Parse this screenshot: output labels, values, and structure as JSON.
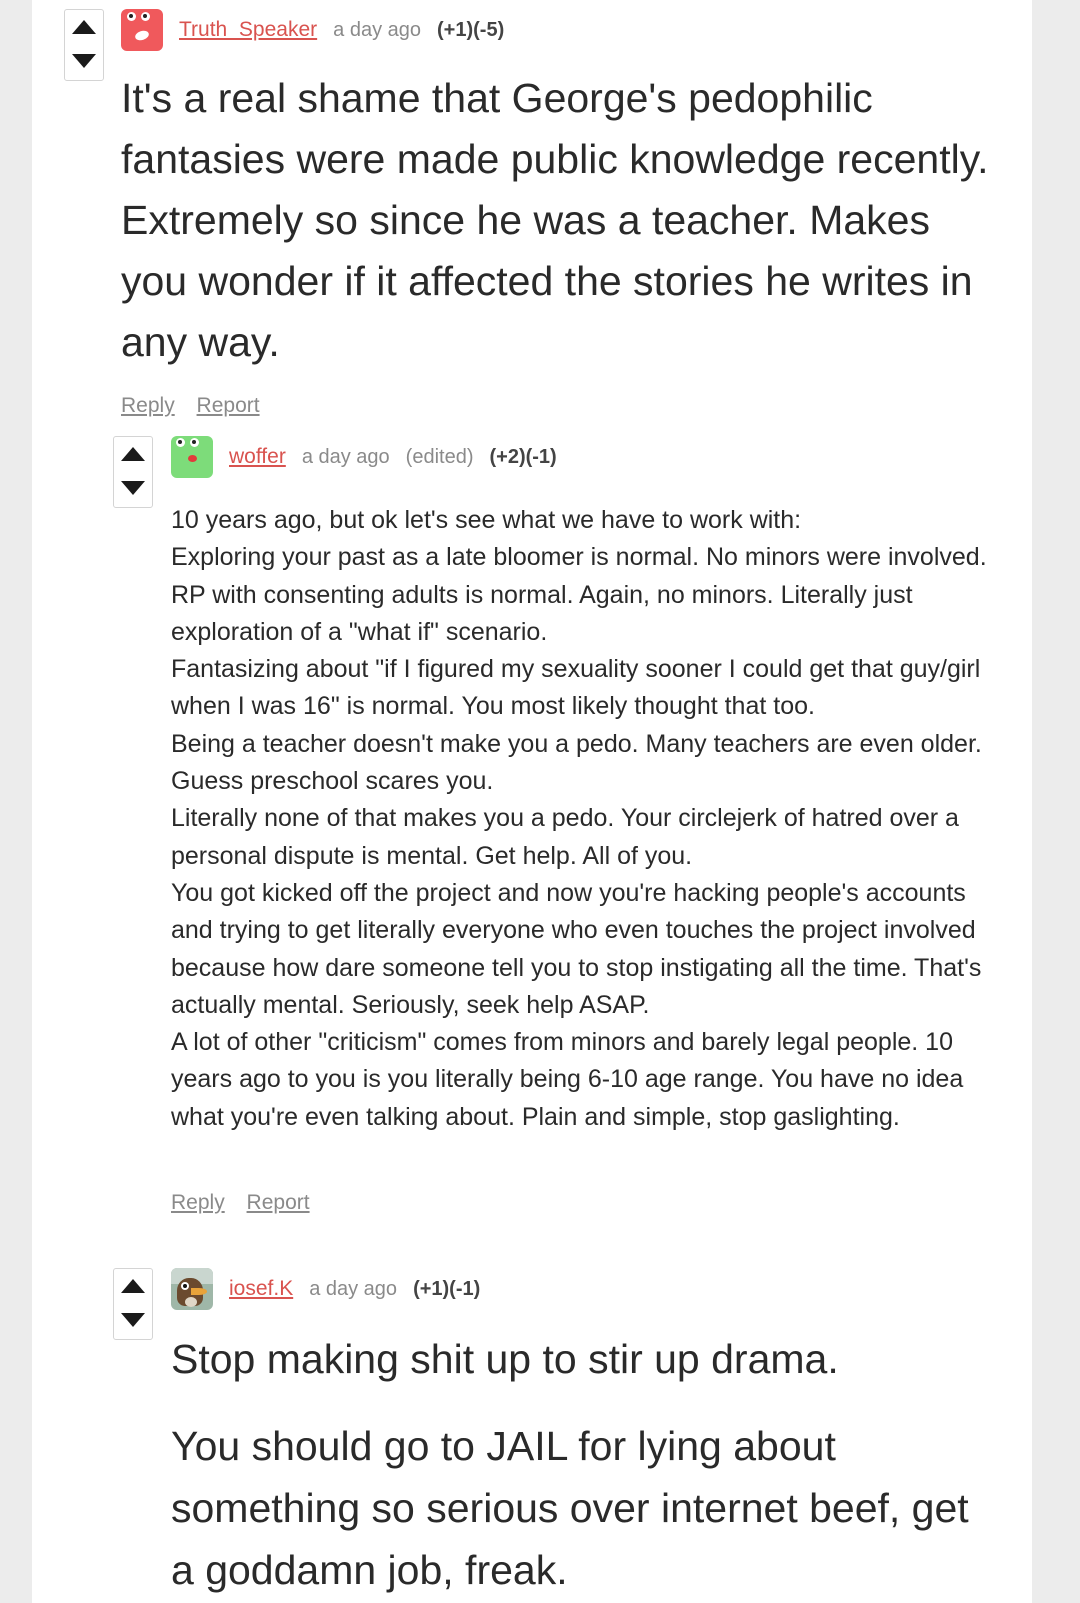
{
  "comments": [
    {
      "username": "Truth_Speaker",
      "time": "a day ago",
      "score": "(+1)(-5)",
      "avatar_icon": "red-blob-avatar",
      "avatar_color": "#f0595c",
      "body": [
        "It's a real shame that George's pedophilic fantasies were made public knowledge recently. Extremely so since he was a teacher. Makes you wonder if it affected the stories he writes in any way."
      ],
      "reply_label": "Reply",
      "report_label": "Report"
    },
    {
      "username": "woffer",
      "time": "a day ago",
      "edited": "(edited)",
      "score": "(+2)(-1)",
      "avatar_icon": "green-blob-avatar",
      "avatar_color": "#7ddc7a",
      "body": [
        "10 years ago, but ok let's see what we have to work with:",
        "Exploring your past as a late bloomer is normal. No minors were involved.",
        "RP with consenting adults is normal. Again, no minors. Literally just exploration of a \"what if\" scenario.",
        "Fantasizing about \"if I figured my sexuality sooner I could get that guy/girl when I was 16\" is normal. You most likely thought that too.",
        "Being a teacher doesn't make you a pedo. Many teachers are even older. Guess preschool scares you.",
        "Literally none of that makes you a pedo. Your circlejerk of hatred over a personal dispute is mental. Get help. All of you.",
        "You got kicked off the project and now you're hacking people's accounts and trying to get literally everyone who even touches the project involved because how dare someone tell you to stop instigating all the time. That's actually mental. Seriously, seek help ASAP.",
        "A lot of other \"criticism\" comes from minors and barely legal people. 10 years ago to you is you literally being 6-10 age range. You have no idea what you're even talking about. Plain and simple, stop gaslighting."
      ],
      "reply_label": "Reply",
      "report_label": "Report"
    },
    {
      "username": "iosef.K",
      "time": "a day ago",
      "score": "(+1)(-1)",
      "avatar_icon": "bird-photo-avatar",
      "body": [
        "Stop making shit up to stir up drama.",
        "You should go to JAIL for lying about something so serious over internet beef, get a goddamn job, freak."
      ]
    }
  ]
}
